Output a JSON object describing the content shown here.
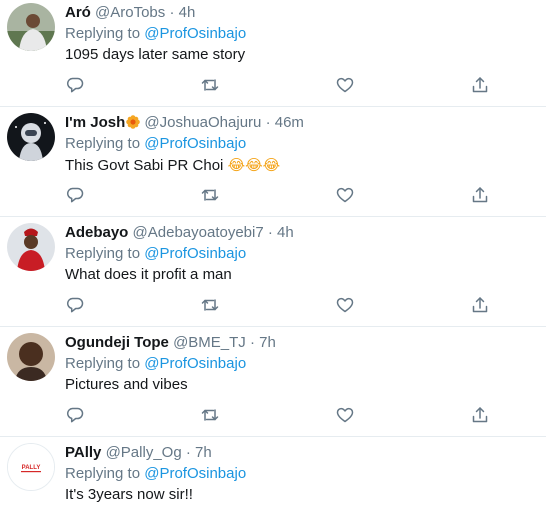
{
  "tweets": [
    {
      "name": "Aró",
      "handle": "@AroTobs",
      "dot": "·",
      "time": "4h",
      "reply_prefix": "Replying to",
      "mention": "@ProfOsinbajo",
      "text": "1095 days later same story"
    },
    {
      "name": "I'm Josh",
      "handle": "@JoshuaOhajuru",
      "dot": "·",
      "time": "46m",
      "reply_prefix": "Replying to",
      "mention": "@ProfOsinbajo",
      "text": "This Govt Sabi PR Choi",
      "emoji": "😂😂😂"
    },
    {
      "name": "Adebayo",
      "handle": "@Adebayoatoyebi7",
      "dot": "·",
      "time": "4h",
      "reply_prefix": "Replying to",
      "mention": "@ProfOsinbajo",
      "text": "What does it profit a man"
    },
    {
      "name": "Ogundeji Tope",
      "handle": "@BME_TJ",
      "dot": "·",
      "time": "7h",
      "reply_prefix": "Replying to",
      "mention": "@ProfOsinbajo",
      "text": "Pictures and vibes"
    },
    {
      "name": "PAlly",
      "handle": "@Pally_Og",
      "dot": "·",
      "time": "7h",
      "reply_prefix": "Replying to",
      "mention": "@ProfOsinbajo",
      "text": "It's 3years now sir!!",
      "avatar_text": "PALLY"
    }
  ],
  "icons": {
    "reply": "reply-icon",
    "retweet": "retweet-icon",
    "like": "like-icon",
    "share": "share-icon"
  },
  "colors": {
    "mention": "#1b95e0",
    "secondary": "#657786",
    "text": "#14171a",
    "divider": "#e6ecf0"
  }
}
